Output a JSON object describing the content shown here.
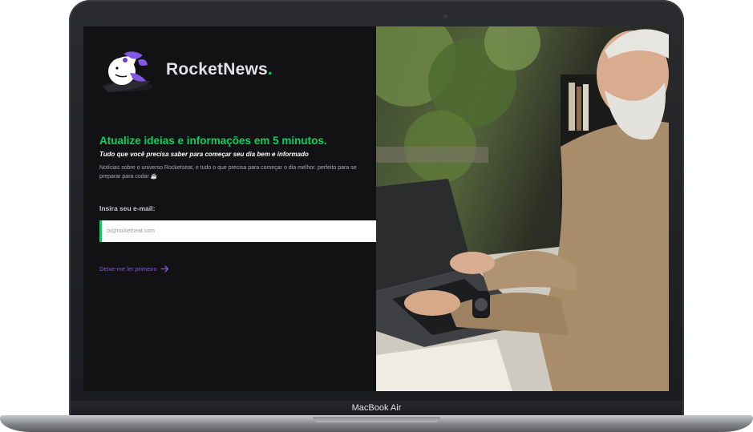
{
  "app": {
    "brand_name": "RocketNews",
    "brand_dot": ".",
    "accent_green": "#04d361",
    "accent_purple": "#8257e5"
  },
  "hero": {
    "headline": "Atualize ideias e informações em 5 minutos.",
    "subheadline": "Tudo que você precisa saber para começar seu dia bem e informado",
    "description": "Notícias sobre o universo Rocketseat, e tudo o que precisa para começar o dia melhor. perfeito para se preparar para codar ☕"
  },
  "form": {
    "email_label": "Insira seu e-mail:",
    "email_placeholder": "oi@rocketseat.com",
    "email_value": "",
    "submit_icon": "send-icon"
  },
  "link": {
    "read_first": "Deixe-me ler primeiro",
    "icon": "arrow-right-icon"
  },
  "device": {
    "label": "MacBook Air"
  }
}
